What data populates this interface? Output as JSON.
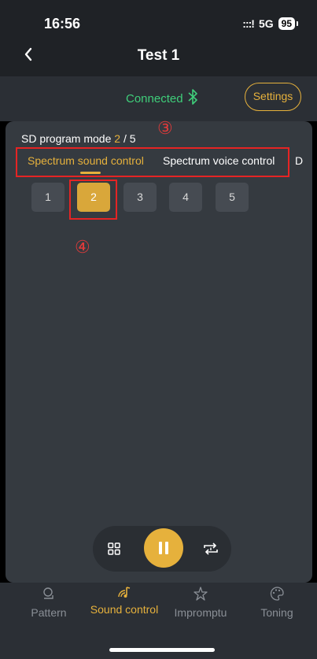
{
  "status_bar": {
    "time": "16:56",
    "signal": ":::!",
    "network": "5G",
    "battery": "95"
  },
  "header": {
    "title": "Test 1"
  },
  "connection": {
    "status": "Connected",
    "settings_label": "Settings"
  },
  "program": {
    "label": "SD program mode",
    "current": "2",
    "separator": " / ",
    "total": "5"
  },
  "annotations": {
    "tabs_marker": "③",
    "number_marker": "④"
  },
  "tabs": [
    {
      "label": "Spectrum sound control",
      "active": true
    },
    {
      "label": "Spectrum voice control",
      "active": false
    },
    {
      "label": "D",
      "active": false
    }
  ],
  "numbers": [
    {
      "label": "1",
      "selected": false
    },
    {
      "label": "2",
      "selected": true
    },
    {
      "label": "3",
      "selected": false
    },
    {
      "label": "4",
      "selected": false
    },
    {
      "label": "5",
      "selected": false
    }
  ],
  "bottom_nav": [
    {
      "label": "Pattern",
      "icon": "pattern-icon",
      "active": false
    },
    {
      "label": "Sound control",
      "icon": "sound-control-icon",
      "active": true
    },
    {
      "label": "Impromptu",
      "icon": "impromptu-icon",
      "active": false
    },
    {
      "label": "Toning",
      "icon": "palette-icon",
      "active": false
    }
  ],
  "colors": {
    "accent": "#e6b13c",
    "connected": "#3fce7a",
    "annotation": "#e52424"
  }
}
